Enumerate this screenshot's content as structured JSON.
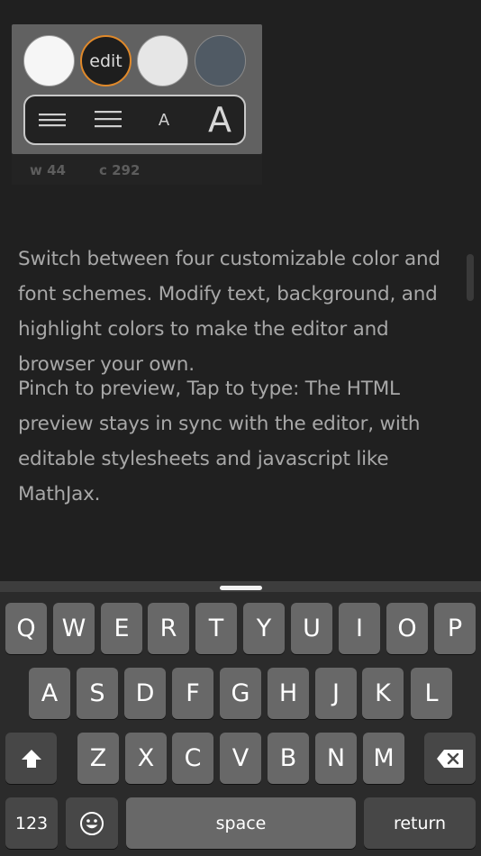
{
  "toolbar": {
    "swatch_edit_label": "edit",
    "font_small": "A",
    "font_large": "A",
    "words": "w 44",
    "chars": "c 292"
  },
  "editor": {
    "paragraph1": "Switch between four customizable color and font schemes. Modify text, background, and highlight colors to make the editor and browser your own.",
    "paragraph2": "Pinch to preview, Tap to type: The HTML preview stays in sync with the editor, with editable stylesheets and javascript like MathJax."
  },
  "keyboard": {
    "row1": [
      "Q",
      "W",
      "E",
      "R",
      "T",
      "Y",
      "U",
      "I",
      "O",
      "P"
    ],
    "row2": [
      "A",
      "S",
      "D",
      "F",
      "G",
      "H",
      "J",
      "K",
      "L"
    ],
    "row3": [
      "Z",
      "X",
      "C",
      "V",
      "B",
      "N",
      "M"
    ],
    "numbers": "123",
    "space": "space",
    "return": "return"
  },
  "colors": {
    "accent": "#e0892a",
    "background": "#202020",
    "key": "#686868",
    "key_dark": "#474747"
  }
}
